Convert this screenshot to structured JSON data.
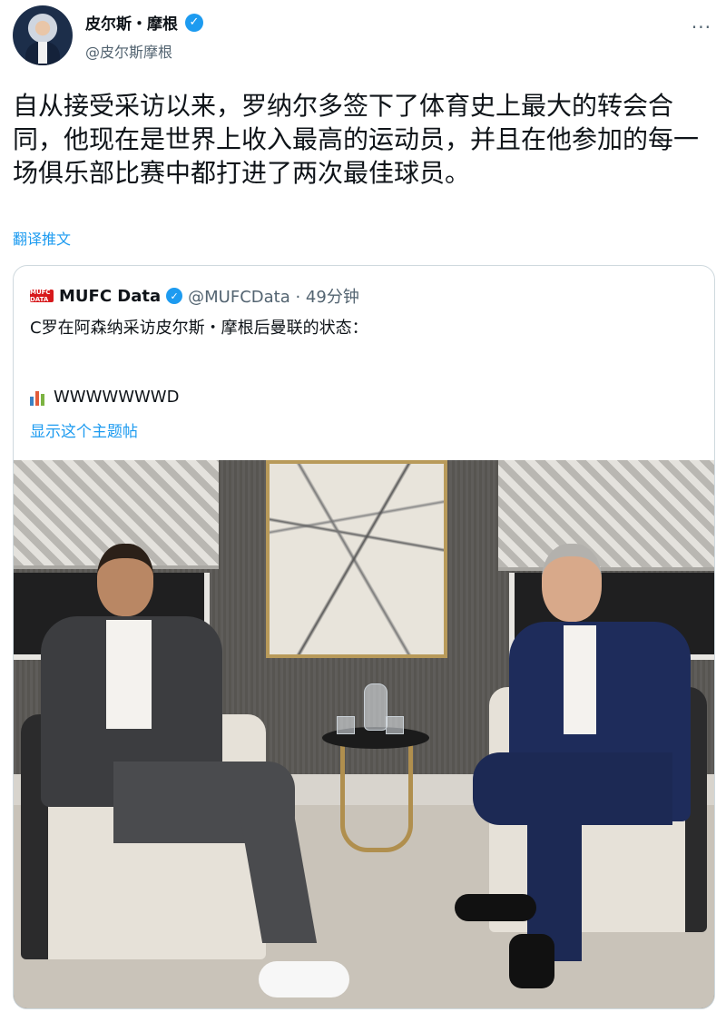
{
  "header": {
    "display_name": "皮尔斯・摩根",
    "handle": "@皮尔斯摩根",
    "verified_mark": "✓",
    "more_label": "···"
  },
  "tweet": {
    "text": "自从接受采访以来，罗纳尔多签下了体育史上最大的转会合同，他现在是世界上收入最高的运动员，并且在他参加的每一场俱乐部比赛中都打进了两次最佳球员。",
    "translate_label": "翻译推文"
  },
  "quote": {
    "logo_text": "MUFC DATA",
    "name": "MUFC Data",
    "verified_mark": "✓",
    "meta": "@MUFCData · 49分钟",
    "text": "C罗在阿森纳采访皮尔斯・摩根后曼联的状态：",
    "poll_text": "WWWWWWWD",
    "poll_icon_colors": [
      "#3b82c4",
      "#e25c3a",
      "#7cb342"
    ],
    "show_thread_label": "显示这个主题帖"
  },
  "icons": {
    "verified": "verified-badge-icon",
    "more": "more-options-icon",
    "poll": "bar-chart-icon",
    "mufc": "mufc-logo-icon"
  },
  "colors": {
    "link": "#1d9bf0",
    "text": "#0f1419",
    "muted": "#536471"
  }
}
